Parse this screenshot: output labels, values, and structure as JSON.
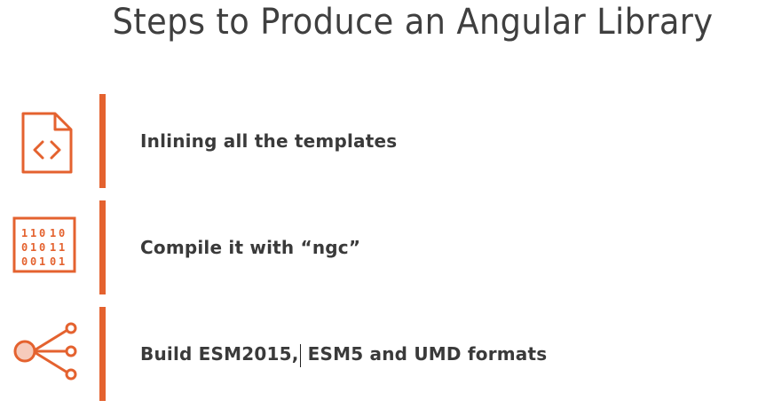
{
  "slide": {
    "title": "Steps to Produce an Angular Library",
    "accent_color": "#e4622f",
    "steps": [
      {
        "icon": "code-file-icon",
        "label": "Inlining all the templates"
      },
      {
        "icon": "binary-grid-icon",
        "label": "Compile it with “ngc”"
      },
      {
        "icon": "share-node-icon",
        "label_before_cursor": "Build ESM2015,",
        "label_after_cursor": " ESM5 and UMD formats"
      }
    ]
  }
}
